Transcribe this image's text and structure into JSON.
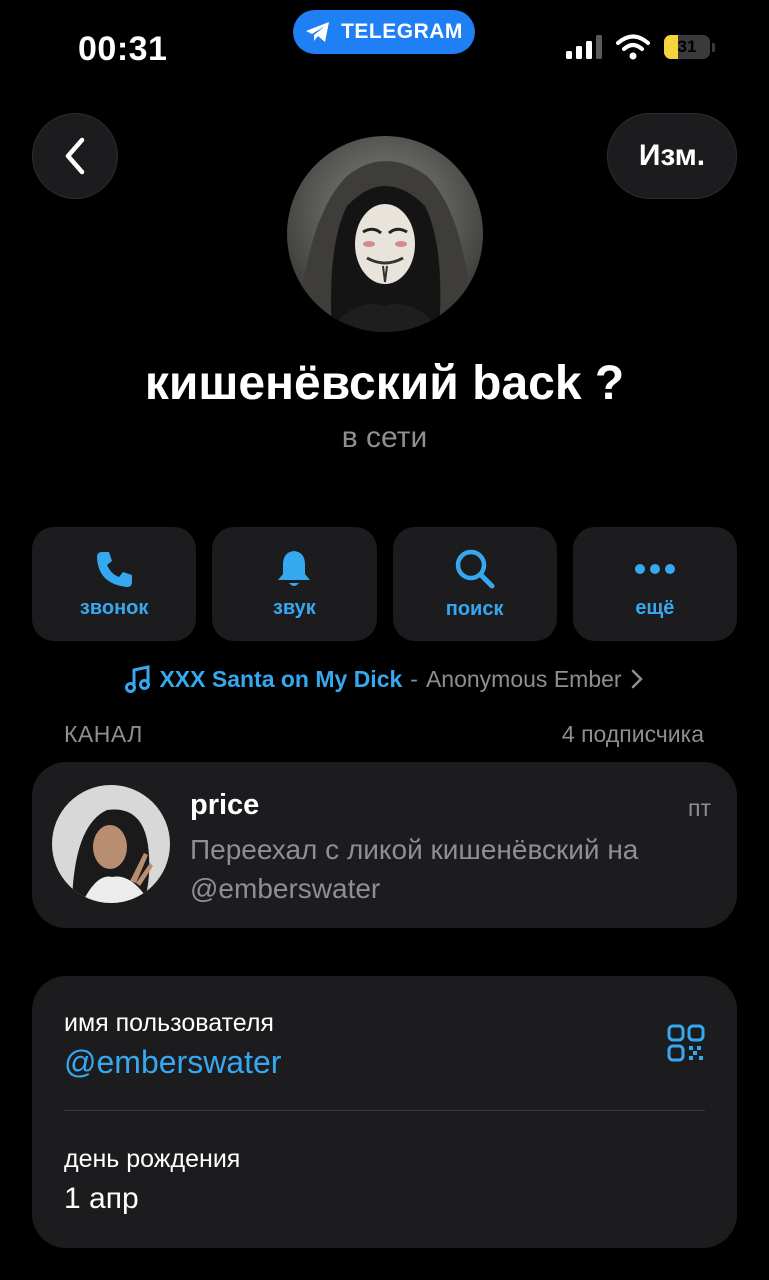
{
  "status_bar": {
    "time": "00:31",
    "app_pill": "TELEGRAM",
    "battery": "31",
    "battery_level": 0.31
  },
  "nav": {
    "edit_label": "Изм."
  },
  "profile": {
    "name": "кишенёвский back ?",
    "status": "в сети"
  },
  "actions": [
    {
      "label": "звонок",
      "icon": "phone-icon"
    },
    {
      "label": "звук",
      "icon": "bell-icon"
    },
    {
      "label": "поиск",
      "icon": "search-icon"
    },
    {
      "label": "ещё",
      "icon": "more-icon"
    }
  ],
  "music": {
    "title": "XXX Santa on My Dick",
    "separator": "-",
    "artist": "Anonymous Ember"
  },
  "channel_section": {
    "label": "КАНАЛ",
    "subscribers": "4 подписчика"
  },
  "channel": {
    "title": "price",
    "day": "пт",
    "text": "Переехал с ликой кишенёвский на @emberswater"
  },
  "info": {
    "username_label": "имя пользователя",
    "username": "@emberswater",
    "birthday_label": "день рождения",
    "birthday": "1 апр"
  },
  "colors": {
    "accent": "#36a8f0",
    "background": "#000000",
    "card": "#1c1c1e",
    "secondary_text": "#8e8e93",
    "telegram_pill": "#1f7ff5",
    "battery": "#f7d43b"
  }
}
